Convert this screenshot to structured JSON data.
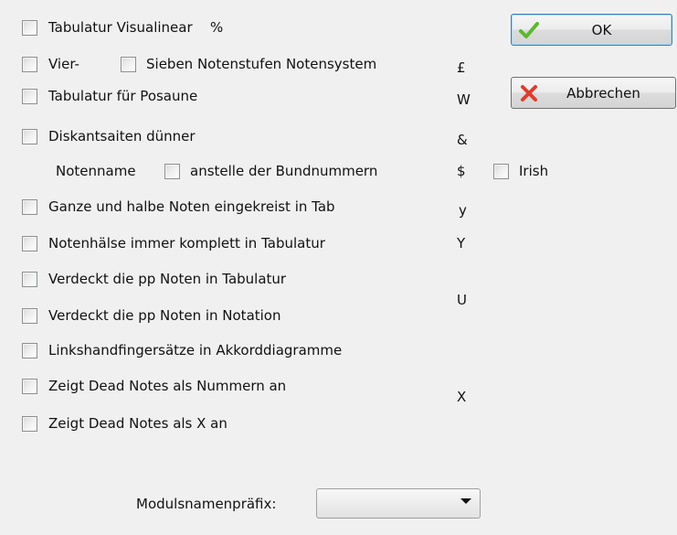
{
  "options": [
    {
      "label": "Tabulatur Visualinear",
      "shortcut": "%"
    },
    {
      "label": "Vier-",
      "shortcut": ""
    },
    {
      "label": "Sieben Notenstufen Notensystem",
      "shortcut": "£"
    },
    {
      "label": "Tabulatur für Posaune",
      "shortcut": "W"
    },
    {
      "label": "Diskantsaiten dünner",
      "shortcut": "&"
    },
    {
      "label": "anstelle der Bundnummern",
      "shortcut": "$"
    },
    {
      "label": "Irish",
      "shortcut": ""
    },
    {
      "label": "Ganze und halbe Noten eingekreist in Tab",
      "shortcut": "y"
    },
    {
      "label": "Notenhälse immer komplett in Tabulatur",
      "shortcut": "Y"
    },
    {
      "label": "Verdeckt die pp Noten in Tabulatur",
      "shortcut": ""
    },
    {
      "label": "Verdeckt die pp Noten in Notation",
      "shortcut": "U"
    },
    {
      "label": "Linkshandfingersätze in Akkorddiagramme",
      "shortcut": ""
    },
    {
      "label": "Zeigt Dead Notes als Nummern an",
      "shortcut": ""
    },
    {
      "label": "Zeigt Dead Notes als X an",
      "shortcut": "X"
    }
  ],
  "notenname_label": "Notenname",
  "buttons": {
    "ok": "OK",
    "cancel": "Abbrechen"
  },
  "icons": {
    "ok": "checkmark-icon",
    "cancel": "red-x-icon"
  },
  "colors": {
    "ok_icon": "#5cb82e",
    "cancel_icon": "#e23b2a",
    "dialog_bg": "#f0f0f0"
  },
  "module_prefix": {
    "label": "Modulsnamenpräfix:",
    "value": ""
  }
}
